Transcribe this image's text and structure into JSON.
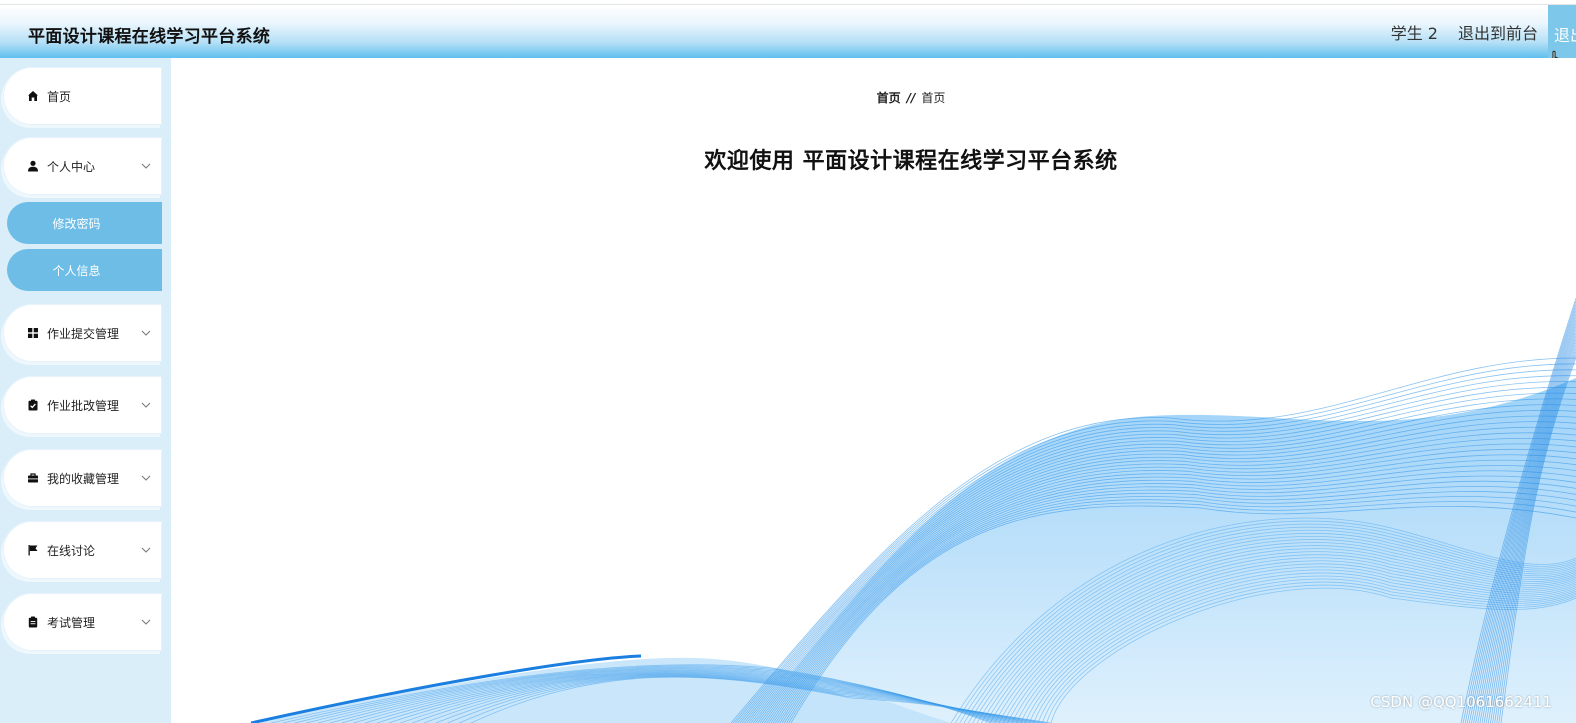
{
  "header": {
    "title": "平面设计课程在线学习平台系统",
    "user_name": "学生 2",
    "back_to_front": "退出到前台",
    "logout_partial": "退出"
  },
  "sidebar": {
    "items": [
      {
        "label": "首页",
        "icon": "home-icon",
        "expandable": false
      },
      {
        "label": "个人中心",
        "icon": "person-icon",
        "expandable": true,
        "expanded": true,
        "children": [
          {
            "label": "修改密码"
          },
          {
            "label": "个人信息"
          }
        ]
      },
      {
        "label": "作业提交管理",
        "icon": "grid-icon",
        "expandable": true
      },
      {
        "label": "作业批改管理",
        "icon": "clipboard-check-icon",
        "expandable": true
      },
      {
        "label": "我的收藏管理",
        "icon": "briefcase-icon",
        "expandable": true
      },
      {
        "label": "在线讨论",
        "icon": "flag-icon",
        "expandable": true
      },
      {
        "label": "考试管理",
        "icon": "clipboard-icon",
        "expandable": true
      }
    ]
  },
  "main": {
    "breadcrumb": {
      "first": "首页",
      "separator": "//",
      "current": "首页"
    },
    "welcome": "欢迎使用 平面设计课程在线学习平台系统"
  },
  "watermark": "CSDN @QQ1061662411",
  "colors": {
    "accent": "#6dbde6",
    "sidebar_bg": "#d9eef9",
    "header_gradient_end": "#5fc0ee",
    "wave_blue": "#1a8fe8"
  }
}
